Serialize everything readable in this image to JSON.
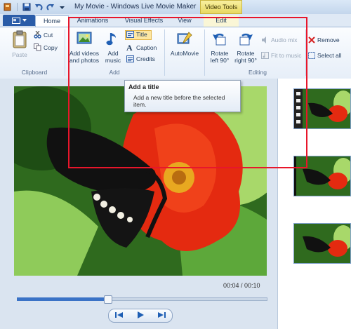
{
  "window": {
    "title": "My Movie - Windows Live Movie Maker",
    "context_group": "Video Tools"
  },
  "tabs": [
    {
      "label": "Home",
      "active": true
    },
    {
      "label": "Animations"
    },
    {
      "label": "Visual Effects"
    },
    {
      "label": "View"
    },
    {
      "label": "Edit",
      "contextual": true
    }
  ],
  "ribbon": {
    "clipboard": {
      "paste": "Paste",
      "cut": "Cut",
      "copy": "Copy",
      "group": "Clipboard"
    },
    "add": {
      "add_videos": "Add videos",
      "and_photos": "and photos",
      "add_music_1": "Add",
      "add_music_2": "music",
      "title": "Title",
      "caption": "Caption",
      "credits": "Credits",
      "group": "Add"
    },
    "automovie": {
      "label": "AutoMovie"
    },
    "editing": {
      "rotate_left_1": "Rotate",
      "rotate_left_2": "left 90°",
      "rotate_right_1": "Rotate",
      "rotate_right_2": "right 90°",
      "audio_mix": "Audio mix",
      "fit_to_music": "Fit to music",
      "remove": "Remove",
      "select_all": "Select all",
      "group": "Editing"
    }
  },
  "tooltip": {
    "title": "Add a title",
    "text": "Add a new title before the selected item."
  },
  "player": {
    "time": "00:04 / 00:10",
    "progress": 0.36
  },
  "icons": [
    "file-menu-icon",
    "save-icon",
    "undo-icon",
    "redo-icon",
    "paste-icon",
    "cut-icon",
    "copy-icon",
    "add-videos-icon",
    "music-note-icon",
    "title-icon",
    "caption-icon",
    "credits-icon",
    "automovie-icon",
    "rotate-left-icon",
    "rotate-right-icon",
    "audio-mix-icon",
    "fit-to-music-icon",
    "remove-icon",
    "select-all-icon",
    "previous-frame-icon",
    "play-icon",
    "next-frame-icon"
  ],
  "colors": {
    "accent": "#2a5ca8",
    "highlight_box": "#e8162b",
    "contextual_tab": "#f3e58a"
  }
}
